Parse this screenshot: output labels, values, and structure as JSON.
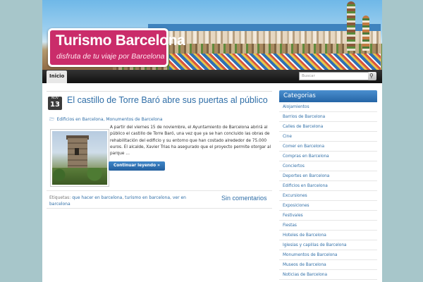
{
  "header": {
    "site_title": "Turismo Barcelona",
    "tagline": "disfruta de tu viaje por Barcelona"
  },
  "nav": {
    "items": [
      {
        "label": "Inicio"
      }
    ],
    "search_placeholder": "Buscar"
  },
  "post": {
    "date_month": "NOV",
    "date_day": "13",
    "title": "El castillo de Torre Baró abre sus puertas al público",
    "categories": "Edificios en Barcelona, Monumentos de Barcelona",
    "excerpt": "A partir del viernes 15 de noviembre, el Ayuntamiento de Barcelona abrirá al público el castillo de Torre Baró, una vez que ya se han concluido las obras de rehabilitación del edificio y su entorno que han costado alrededor de 75.000 euros. El alcalde, Xavier Trias ha asegurado que el proyecto permite otorgar al parque …",
    "read_more": "Continuar leyendo »",
    "tags_label": "Etiquetas:",
    "tags": [
      "que hacer en barcelona",
      "turismo en barcelona",
      "ver en barcelona"
    ],
    "comments": "Sin comentarios"
  },
  "sidebar": {
    "heading": "Categorias",
    "categories": [
      "Alojamientos",
      "Barrios de Barcelona",
      "Calles de Barcelona",
      "Cine",
      "Comer en Barcelona",
      "Compras en Barcelona",
      "Conciertos",
      "Deportes en Barcelona",
      "Edificios en Barcelona",
      "Excursiones",
      "Exposiciones",
      "Festivales",
      "Fiestas",
      "Hoteles de Barcelona",
      "Iglesias y capillas de Barcelona",
      "Monumentos de Barcelona",
      "Museos de Barcelona",
      "Noticias de Barcelona"
    ]
  },
  "colors": {
    "background": "#a7c6ca",
    "brand_pink": "#ca2c6a",
    "link_blue": "#2f6ea7",
    "accent_blue": "#2565a6"
  }
}
